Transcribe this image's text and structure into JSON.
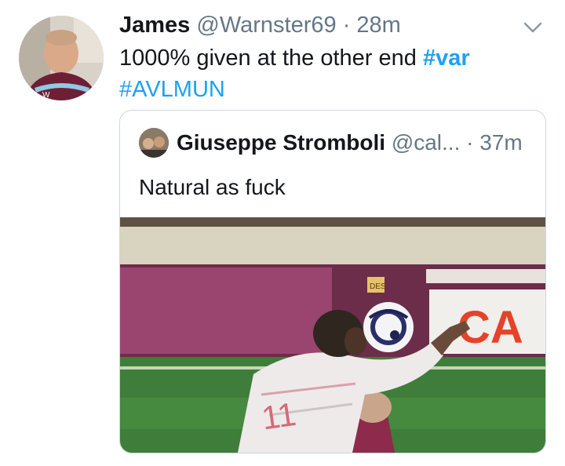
{
  "tweet": {
    "author_name": "James",
    "author_handle": "@Warnster69",
    "separator": "·",
    "time": "28m",
    "text_main": "1000% given at the other end ",
    "hashtag_1": "#var",
    "hashtag_2": "#AVLMUN"
  },
  "quoted": {
    "author_name": "Giuseppe Stromboli",
    "author_handle": "@cal...",
    "separator": "·",
    "time": "37m",
    "text": "Natural as fuck",
    "board_text": "CA",
    "shirt_number": "11"
  },
  "icons": {
    "menu": "chevron-down-icon"
  },
  "colors": {
    "link": "#1da1f2",
    "secondary": "#657786",
    "border": "#ccd6dd"
  }
}
